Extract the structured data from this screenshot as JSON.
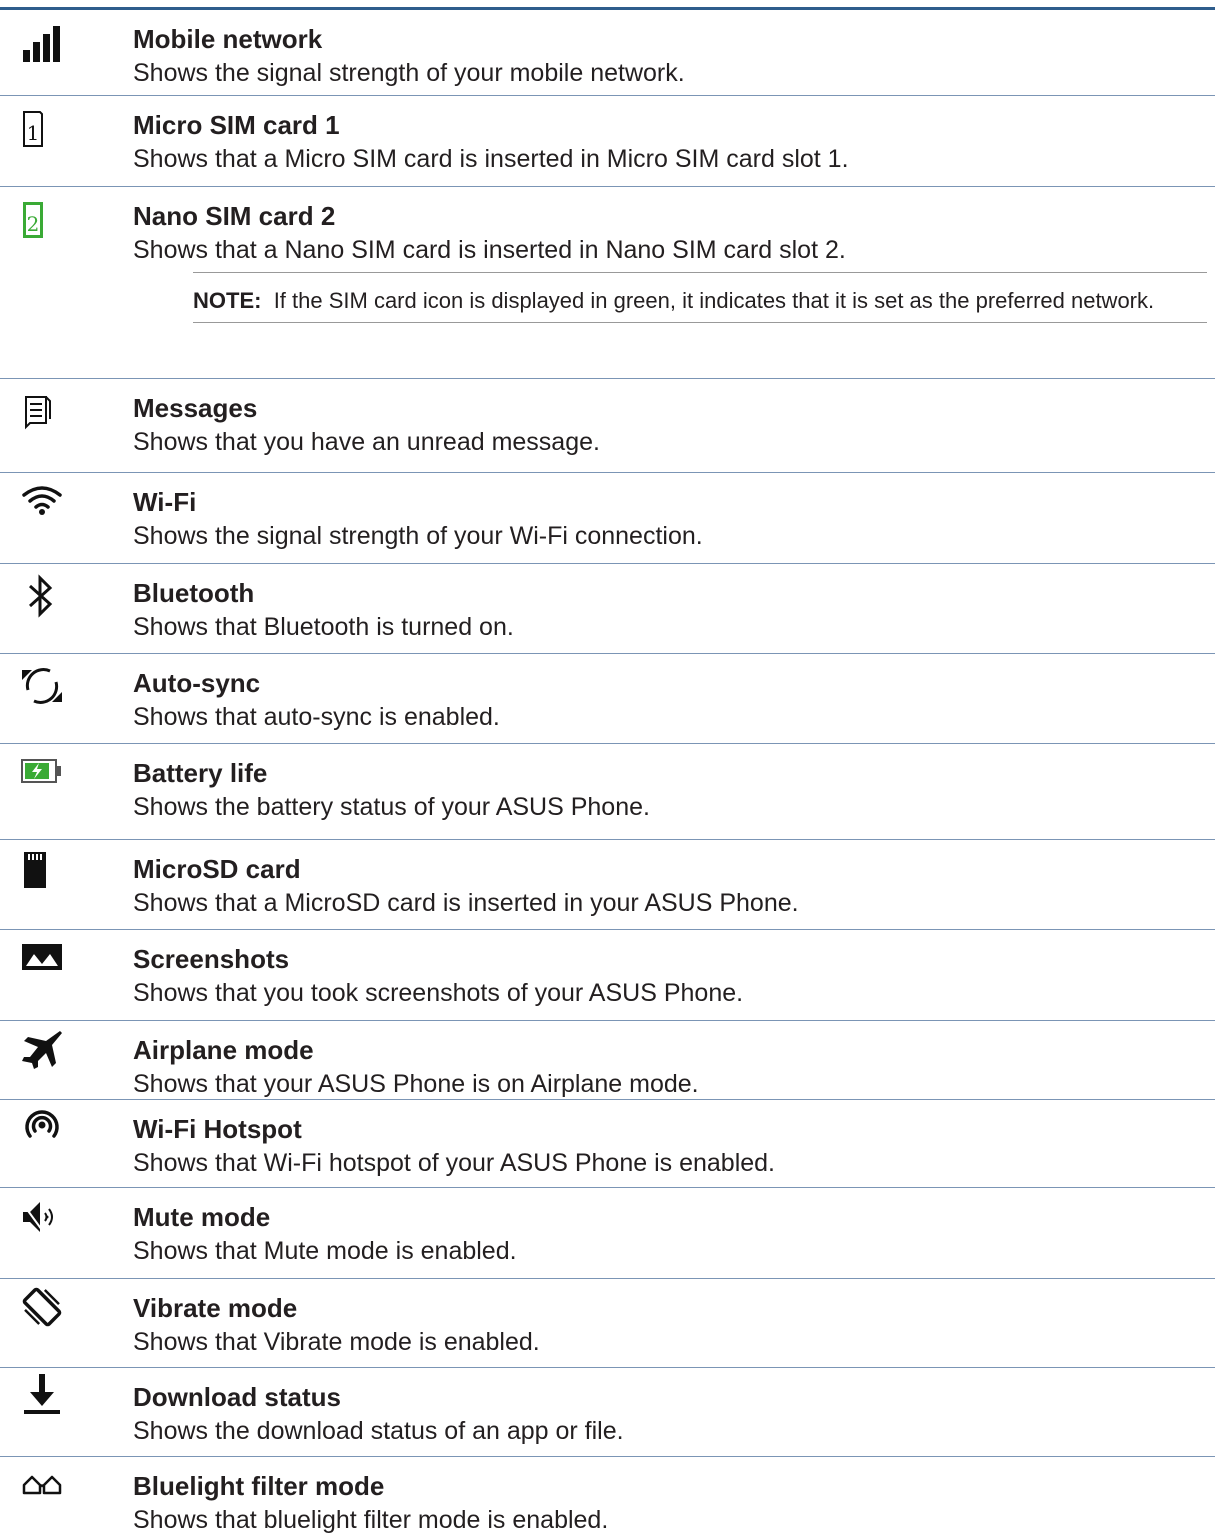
{
  "items": [
    {
      "title": "Mobile network",
      "desc": "Shows the signal strength of your mobile network."
    },
    {
      "title": "Micro SIM card 1",
      "desc": "Shows that a Micro SIM card is inserted in Micro SIM card slot 1."
    },
    {
      "title": "Nano SIM card 2",
      "desc": "Shows that a Nano SIM card is inserted in Nano SIM card slot 2."
    },
    {
      "title": "Messages",
      "desc": "Shows that you have an unread message."
    },
    {
      "title": "Wi-Fi",
      "desc": "Shows the signal strength of your Wi-Fi connection."
    },
    {
      "title": "Bluetooth",
      "desc": "Shows that Bluetooth is turned on."
    },
    {
      "title": "Auto-sync",
      "desc": "Shows that auto-sync is enabled."
    },
    {
      "title": "Battery life",
      "desc": "Shows the battery status of your ASUS Phone."
    },
    {
      "title": "MicroSD card",
      "desc": "Shows that a MicroSD card is inserted in your ASUS Phone."
    },
    {
      "title": "Screenshots",
      "desc": "Shows that you took screenshots of your ASUS Phone."
    },
    {
      "title": "Airplane mode",
      "desc": "Shows that your ASUS Phone is on Airplane mode."
    },
    {
      "title": "Wi-Fi Hotspot",
      "desc": "Shows that Wi-Fi hotspot of your ASUS Phone is enabled."
    },
    {
      "title": "Mute mode",
      "desc": "Shows that Mute mode is enabled."
    },
    {
      "title": "Vibrate mode",
      "desc": "Shows that Vibrate mode is enabled."
    },
    {
      "title": "Download status",
      "desc": "Shows the download status of an app or file."
    },
    {
      "title": "Bluelight filter mode",
      "desc": "Shows that bluelight filter mode is enabled."
    }
  ],
  "note": {
    "label": "NOTE:",
    "text": "If the SIM card icon is displayed in green, it indicates that it is set as the preferred network."
  },
  "icons": [
    "signal-bars-icon",
    "sim-card-1-icon",
    "sim-card-2-icon",
    "message-icon",
    "wifi-icon",
    "bluetooth-icon",
    "sync-icon",
    "battery-icon",
    "microsd-icon",
    "screenshot-icon",
    "airplane-icon",
    "hotspot-icon",
    "mute-icon",
    "vibrate-icon",
    "download-icon",
    "glasses-icon"
  ],
  "colors": {
    "rule": "#2f5d8c",
    "divider": "#7b95b5",
    "green": "#3aaa35",
    "text": "#231f20"
  }
}
